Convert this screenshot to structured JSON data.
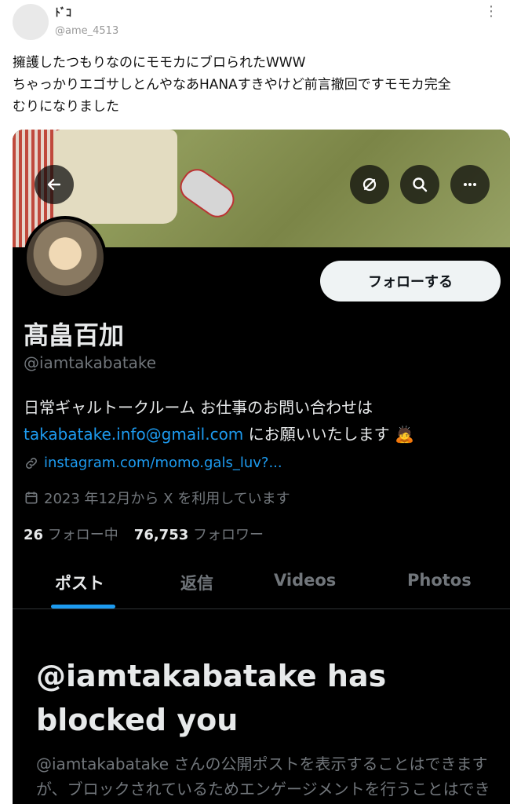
{
  "tweet": {
    "author_name": "ﾄﾞｺ",
    "author_handle": "@ame_4513",
    "text_line1": "擁護したつもりなのにモモカにブロられたWWW",
    "text_line2": "ちゃっかりエゴサしとんやなあHANAすきやけど前言撤回ですモモカ完全",
    "text_line3": "むりになりました"
  },
  "profile": {
    "follow_label": "フォローする",
    "display_name": "髙畠百加",
    "handle": "@iamtakabatake",
    "bio_line1": "日常ギャルトークルーム お仕事のお問い合わせは",
    "bio_email": "takabatake.info@gmail.com",
    "bio_line2_suffix": " にお願いいたします 🙇",
    "website": "instagram.com/momo.gals_luv?...",
    "joined": "2023 年12月から X を利用しています",
    "following_count": "26",
    "following_label": "フォロー中",
    "followers_count": "76,753",
    "followers_label": "フォロワー"
  },
  "tabs": [
    {
      "label": "ポスト"
    },
    {
      "label": "返信"
    },
    {
      "label": "Videos"
    },
    {
      "label": "Photos"
    }
  ],
  "blocked": {
    "title": "@iamtakabatake has blocked you",
    "body": "@iamtakabatake さんの公開ポストを表示することはできますが、ブロックされているためエンゲージメントを行うことはできません。さらに…"
  },
  "icons": [
    "back-arrow-icon",
    "grok-icon",
    "search-icon",
    "more-icon",
    "link-icon",
    "calendar-icon"
  ],
  "colors": {
    "accent": "#1d9bf0",
    "background": "#000000",
    "text": "#e7e9ea",
    "muted": "#71767b"
  }
}
